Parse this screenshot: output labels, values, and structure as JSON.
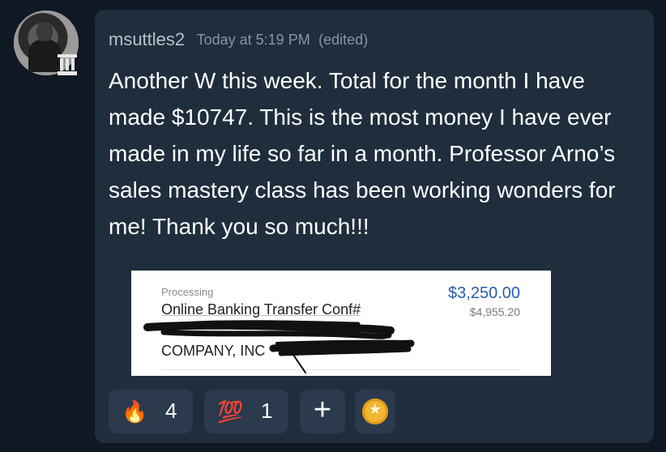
{
  "message": {
    "username": "msuttles2",
    "timestamp": "Today at 5:19 PM",
    "edited": "(edited)",
    "text": "Another W this week. Total for the month I have made $10747. This is the most money I have ever made in my life so far in a month. Professor Arno’s sales mastery class has been working wonders for me! Thank you so much!!!"
  },
  "attachment": {
    "status": "Processing",
    "title": "Online Banking Transfer Conf#",
    "amount": "$3,250.00",
    "balance": "$4,955.20",
    "company": "COMPANY, INC"
  },
  "reactions": [
    {
      "icon": "fire-icon",
      "glyph": "🔥",
      "count": "4"
    },
    {
      "icon": "hundred-points-icon",
      "glyph": "💯",
      "count": "1"
    },
    {
      "icon": "add-reaction-icon",
      "glyph": "+"
    },
    {
      "icon": "gold-coin-icon"
    }
  ],
  "colors": {
    "background": "#0f1823",
    "card": "#1f2d3d",
    "reaction_bg": "#2b3a4c",
    "username": "#b8c2cc",
    "meta": "#8794a1",
    "amount": "#2a5db0"
  }
}
